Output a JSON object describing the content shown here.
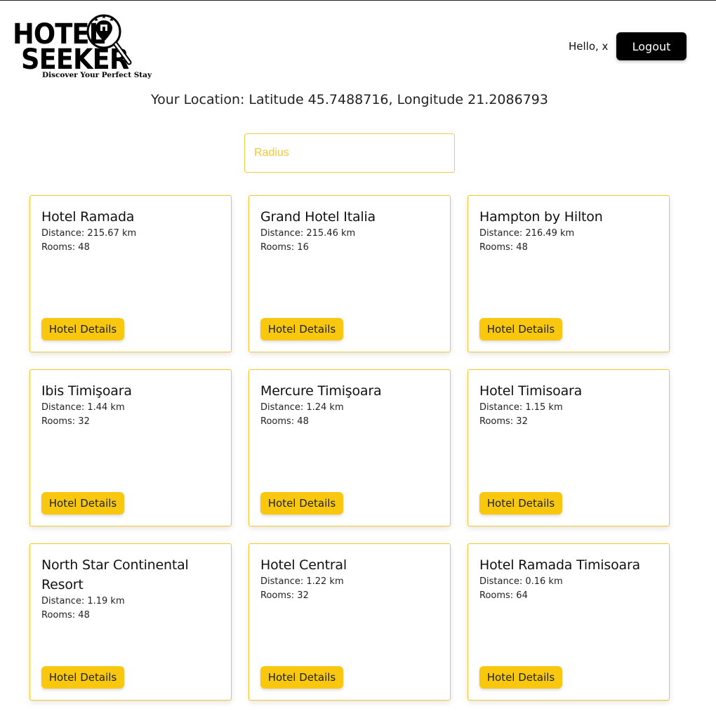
{
  "brand": {
    "line1": "HOTEL",
    "line2": "SEEKER",
    "tagline": "Discover Your Perfect Stay",
    "accent": "#f9c80e"
  },
  "header": {
    "greeting": "Hello, x",
    "logout_label": "Logout"
  },
  "location_text": "Your Location: Latitude 45.7488716, Longitude 21.2086793",
  "radius_input": {
    "placeholder": "Radius",
    "value": ""
  },
  "hotels": [
    {
      "name": "Hotel Ramada",
      "distance": "Distance: 215.67 km",
      "rooms": "Rooms: 48",
      "button": "Hotel Details"
    },
    {
      "name": "Grand Hotel Italia",
      "distance": "Distance: 215.46 km",
      "rooms": "Rooms: 16",
      "button": "Hotel Details"
    },
    {
      "name": "Hampton by Hilton",
      "distance": "Distance: 216.49 km",
      "rooms": "Rooms: 48",
      "button": "Hotel Details"
    },
    {
      "name": "Ibis Timişoara",
      "distance": "Distance: 1.44 km",
      "rooms": "Rooms: 32",
      "button": "Hotel Details"
    },
    {
      "name": "Mercure Timişoara",
      "distance": "Distance: 1.24 km",
      "rooms": "Rooms: 48",
      "button": "Hotel Details"
    },
    {
      "name": "Hotel Timisoara",
      "distance": "Distance: 1.15 km",
      "rooms": "Rooms: 32",
      "button": "Hotel Details"
    },
    {
      "name": "North Star Continental Resort",
      "distance": "Distance: 1.19 km",
      "rooms": "Rooms: 48",
      "button": "Hotel Details"
    },
    {
      "name": "Hotel Central",
      "distance": "Distance: 1.22 km",
      "rooms": "Rooms: 32",
      "button": "Hotel Details"
    },
    {
      "name": "Hotel Ramada Timisoara",
      "distance": "Distance: 0.16 km",
      "rooms": "Rooms: 64",
      "button": "Hotel Details"
    }
  ]
}
